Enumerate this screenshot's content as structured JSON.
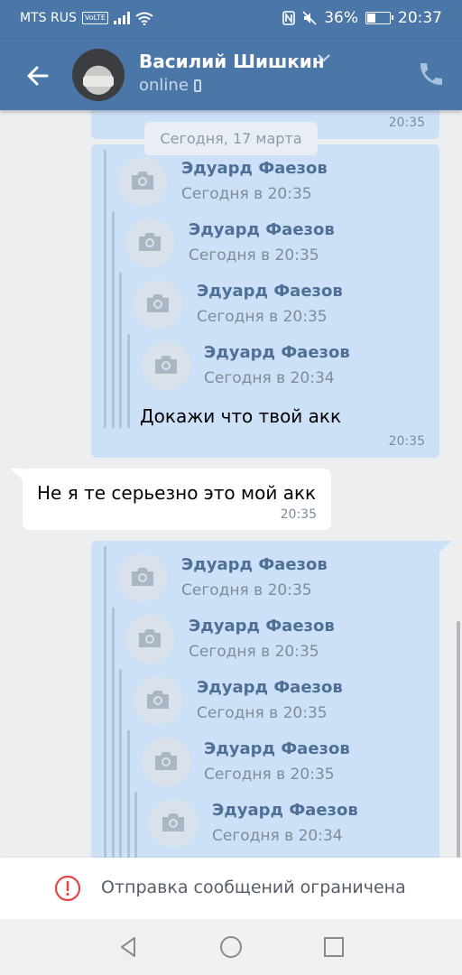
{
  "status_bar": {
    "carrier": "MTS RUS",
    "volte": "VoLTE",
    "battery": "36%",
    "battery_level": 0.36,
    "time": "20:37"
  },
  "header": {
    "name": "Василий Шишкин",
    "status": "online"
  },
  "chat": {
    "top_message_time": "20:35",
    "date_divider": "Сегодня, 17 марта",
    "message1": {
      "forwards": [
        {
          "author": "Эдуард Фаезов",
          "time": "Сегодня в 20:35"
        },
        {
          "author": "Эдуард Фаезов",
          "time": "Сегодня в 20:35"
        },
        {
          "author": "Эдуард Фаезов",
          "time": "Сегодня в 20:35"
        },
        {
          "author": "Эдуард Фаезов",
          "time": "Сегодня в 20:34"
        }
      ],
      "text": "Докажи что твой акк",
      "time": "20:35"
    },
    "message2": {
      "text": "Не я те серьезно это мой акк",
      "time": "20:35"
    },
    "message3": {
      "forwards": [
        {
          "author": "Эдуард Фаезов",
          "time": "Сегодня в 20:35"
        },
        {
          "author": "Эдуард Фаезов",
          "time": "Сегодня в 20:35"
        },
        {
          "author": "Эдуард Фаезов",
          "time": "Сегодня в 20:35"
        },
        {
          "author": "Эдуард Фаезов",
          "time": "Сегодня в 20:35"
        },
        {
          "author": "Эдуард Фаезов",
          "time": "Сегодня в 20:34"
        }
      ]
    }
  },
  "restriction": {
    "text": "Отправка сообщений ограничена"
  },
  "colors": {
    "header_bg": "#4a76a8",
    "outgoing_bubble": "#cce0f8",
    "incoming_bubble": "#ffffff",
    "warning": "#e64646"
  }
}
